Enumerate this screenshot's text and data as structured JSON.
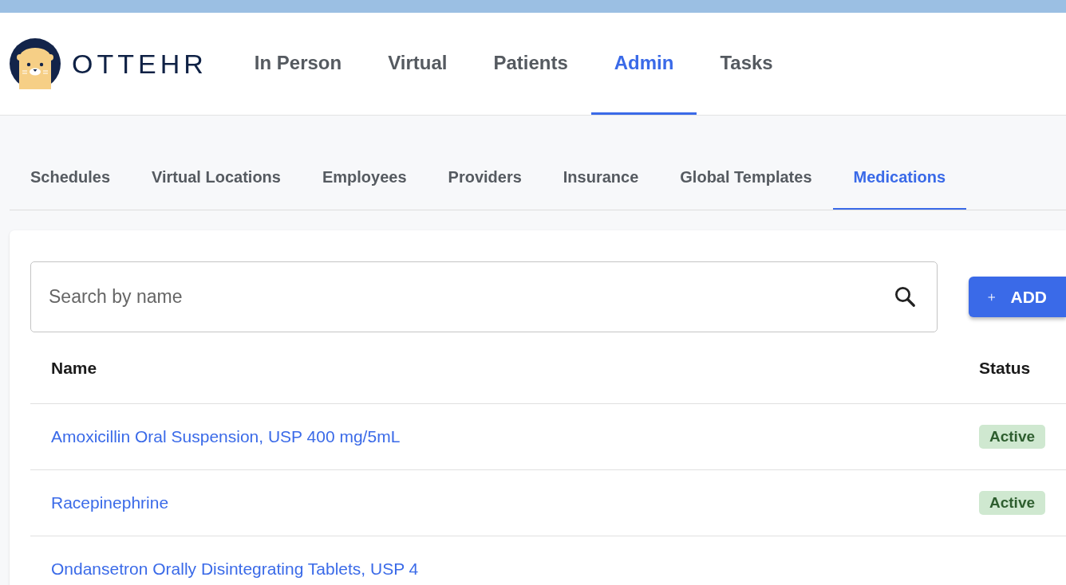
{
  "brand": {
    "name": "OTTEHR"
  },
  "nav": [
    {
      "label": "In Person",
      "selected": false
    },
    {
      "label": "Virtual",
      "selected": false
    },
    {
      "label": "Patients",
      "selected": false
    },
    {
      "label": "Admin",
      "selected": true
    },
    {
      "label": "Tasks",
      "selected": false
    }
  ],
  "tabs": [
    {
      "label": "Schedules",
      "selected": false
    },
    {
      "label": "Virtual Locations",
      "selected": false
    },
    {
      "label": "Employees",
      "selected": false
    },
    {
      "label": "Providers",
      "selected": false
    },
    {
      "label": "Insurance",
      "selected": false
    },
    {
      "label": "Global Templates",
      "selected": false
    },
    {
      "label": "Medications",
      "selected": true
    }
  ],
  "search": {
    "placeholder": "Search by name"
  },
  "add_button": {
    "label": "ADD"
  },
  "table": {
    "columns": [
      "Name",
      "Status"
    ],
    "rows": [
      {
        "name": "Amoxicillin Oral Suspension, USP 400 mg/5mL",
        "status": "Active"
      },
      {
        "name": "Racepinephrine",
        "status": "Active"
      },
      {
        "name": "Ondansetron Orally Disintegrating Tablets, USP 4"
      }
    ]
  }
}
